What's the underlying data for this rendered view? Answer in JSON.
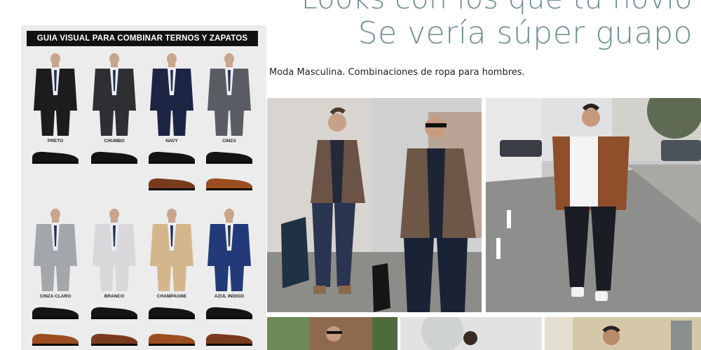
{
  "title": {
    "line1": "Looks con los que tu novio",
    "line2": "Se vería súper guapo"
  },
  "subtitle": "Moda Masculina. Combinaciones de ropa para hombres.",
  "guide": {
    "header": "GUIA VISUAL PARA COMBINAR TERNOS Y ZAPATOS",
    "suits": [
      {
        "label": "PRETO",
        "color": "#1c1c1e"
      },
      {
        "label": "CHUMBO",
        "color": "#2e2f33"
      },
      {
        "label": "NAVY",
        "color": "#1c2544"
      },
      {
        "label": "CINZA",
        "color": "#5a5d63"
      },
      {
        "label": "CINZA CLARO",
        "color": "#a3a6aa"
      },
      {
        "label": "BRANCO",
        "color": "#d8d8da"
      },
      {
        "label": "CHAMPAGNE",
        "color": "#d3b68c"
      },
      {
        "label": "AZUL INDIGO",
        "color": "#233a78"
      }
    ],
    "shoe_colors": {
      "black": "#141414",
      "brown": "#7a3a1e",
      "tan": "#9c4d22"
    }
  }
}
